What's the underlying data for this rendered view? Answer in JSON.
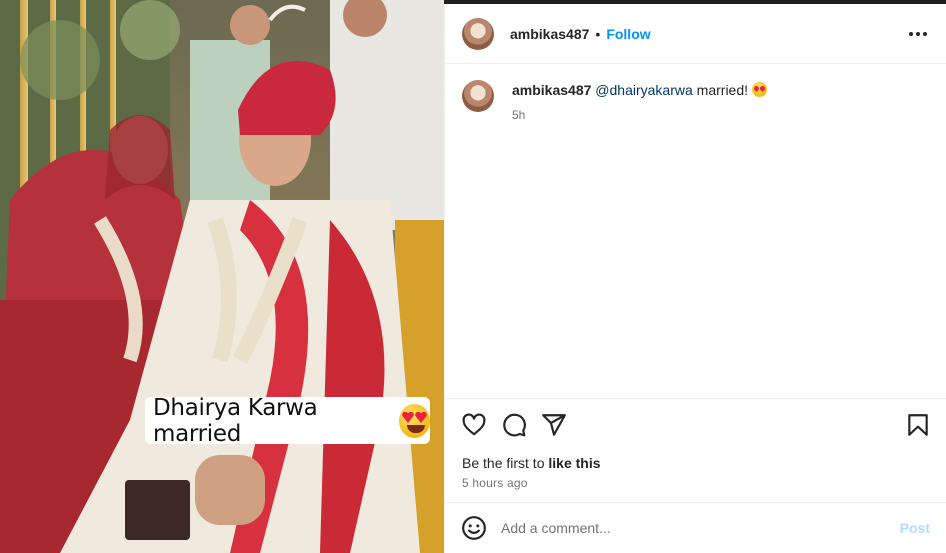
{
  "post": {
    "username": "ambikas487",
    "follow_label": "Follow",
    "separator": "•",
    "image_caption": "Dhairya Karwa married",
    "caption": {
      "username": "ambikas487",
      "mention": "@dhairyakarwa",
      "text": " married! ",
      "time": "5h"
    },
    "likes_prefix": "Be the first to ",
    "likes_link": "like this",
    "posted_ago": "5 hours ago"
  },
  "comment_box": {
    "placeholder": "Add a comment...",
    "post_label": "Post"
  },
  "icons": {
    "more": "more-options-icon",
    "like": "heart-icon",
    "comment": "comment-bubble-icon",
    "share": "paper-plane-icon",
    "save": "bookmark-icon",
    "emoji": "smiley-icon"
  },
  "colors": {
    "follow": "#0095f6",
    "mention": "#00376b",
    "post_disabled": "#b3dbff",
    "secondary_text": "#737373"
  }
}
